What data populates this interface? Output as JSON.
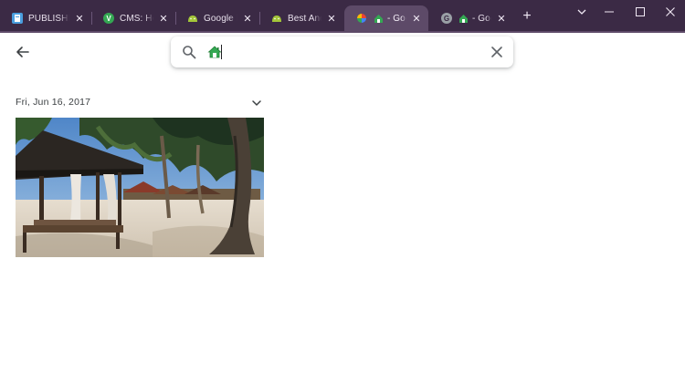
{
  "browser": {
    "tabs": [
      {
        "title": "PUBLISHR: Edit",
        "favicon": "publishr-icon",
        "color": "#4a9ede"
      },
      {
        "title": "CMS: How to",
        "favicon": "cms-v-icon",
        "color": "#34a853"
      },
      {
        "title": "Google Photos",
        "favicon": "android-photos-icon",
        "color": "#a4c639"
      },
      {
        "title": "Best Android",
        "favicon": "android-icon",
        "color": "#a4c639"
      },
      {
        "title": "- Google",
        "favicon": "pinwheel-icon",
        "color": "#ea4335",
        "active": true
      },
      {
        "title": "- Google",
        "favicon": "google-g-icon",
        "color": "#9aa0a6"
      }
    ],
    "close_glyph": "✕",
    "newtab_glyph": "+"
  },
  "page": {
    "date_label": "Fri, Jun 16, 2017",
    "search_emoji_name": "house-emoji-icon"
  },
  "colors": {
    "tabstrip_bg": "#3b2a45",
    "active_tab_bg": "#5d4a68",
    "accent_green": "#34a853"
  }
}
